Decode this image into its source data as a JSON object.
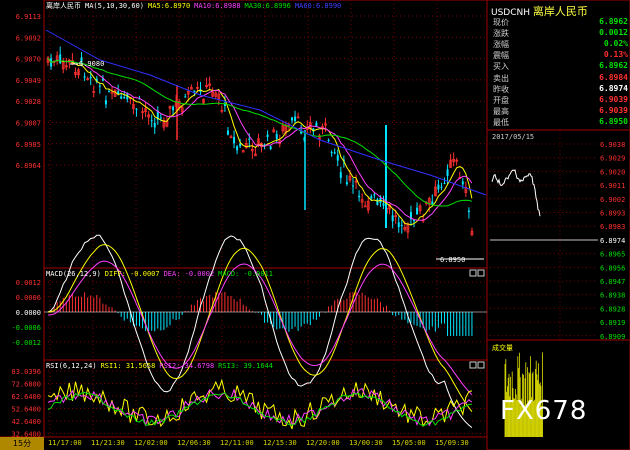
{
  "main_panel": {
    "title": "离岸人民币",
    "ma_label": "MA(5,10,30,60)",
    "ma5": "MA5:6.8970",
    "ma10": "MA10:6.8988",
    "ma30": "MA30:6.8996",
    "ma60": "MA60:6.8990",
    "y_ticks": [
      "6.9113",
      "6.9092",
      "6.9070",
      "6.9049",
      "6.9028",
      "6.9007",
      "6.8985",
      "6.8964"
    ],
    "high_annotation": "6.9080",
    "low_annotation": "6.8950"
  },
  "macd_panel": {
    "label": "MACD(26,12,9)",
    "diff": "DIFF: -0.0007",
    "dea": "DEA: -0.0002",
    "macd": "MACD: -0.0011",
    "y_ticks": [
      "0.0012",
      "0.0006",
      "0.0000",
      "-0.0006",
      "-0.0012"
    ]
  },
  "rsi_panel": {
    "label": "RSI(6,12,24)",
    "rsi1": "RSI1: 31.5658",
    "rsi2": "RSI2: 34.6798",
    "rsi3": "RSI3: 39.1644",
    "y_ticks": [
      "83.0396",
      "72.6800",
      "62.6400",
      "52.6400",
      "42.6400",
      "32.6400"
    ]
  },
  "x_axis": {
    "timeframe": "15分",
    "labels": [
      "11/17:00",
      "11/21:30",
      "12/02:00",
      "12/06:30",
      "12/11:00",
      "12/15:30",
      "12/20:00",
      "13/00:30",
      "15/05:00",
      "15/09:30"
    ]
  },
  "quote": {
    "symbol": "USDCNH",
    "name": "离岸人民币",
    "rows": [
      {
        "label": "现价",
        "value": "6.8962",
        "color": "#00e000"
      },
      {
        "label": "涨跌",
        "value": "0.0012",
        "color": "#00e000"
      },
      {
        "label": "涨幅",
        "value": "0.02%",
        "color": "#00e000"
      },
      {
        "label": "震幅",
        "value": "0.13%",
        "color": "#ff3030"
      },
      {
        "label": "买入",
        "value": "6.8962",
        "color": "#00e000"
      },
      {
        "label": "卖出",
        "value": "6.8984",
        "color": "#ff3030"
      },
      {
        "label": "昨收",
        "value": "6.8974",
        "color": "#ffffff"
      },
      {
        "label": "开盘",
        "value": "6.9039",
        "color": "#ff3030"
      },
      {
        "label": "最高",
        "value": "6.9039",
        "color": "#ff3030"
      },
      {
        "label": "最低",
        "value": "6.8950",
        "color": "#00e000"
      }
    ]
  },
  "intraday": {
    "date": "2017/05/15",
    "y_ticks": [
      "6.9038",
      "6.9029",
      "6.9020",
      "6.9011",
      "6.9002",
      "6.8993",
      "6.8983",
      "6.8974",
      "6.8965",
      "6.8956",
      "6.8947",
      "6.8938",
      "6.8928",
      "6.8919",
      "6.8909"
    ],
    "volume_label": "成交量"
  },
  "watermark": "FX678"
}
